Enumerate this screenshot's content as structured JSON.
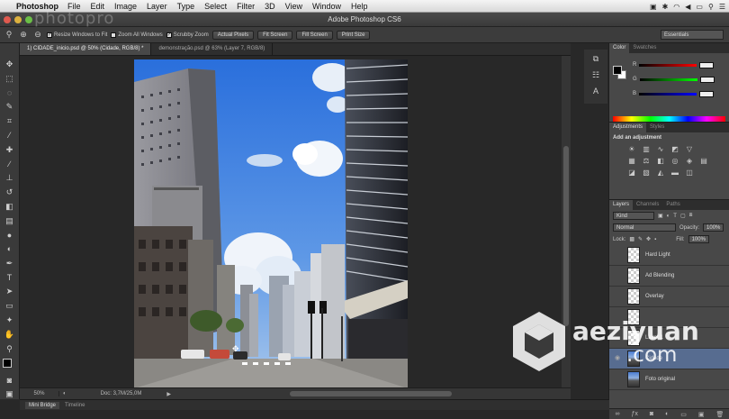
{
  "menubar": {
    "app_name": "Photoshop",
    "items": [
      "File",
      "Edit",
      "Image",
      "Layer",
      "Type",
      "Select",
      "Filter",
      "3D",
      "View",
      "Window",
      "Help"
    ]
  },
  "titlebar": {
    "title": "Adobe Photoshop CS6"
  },
  "watermark_top": "photopro",
  "options_bar": {
    "resize_windows": "Resize Windows to Fit",
    "zoom_all": "Zoom All Windows",
    "scrubby": "Scrubby Zoom",
    "actual_pixels": "Actual Pixels",
    "fit_screen": "Fit Screen",
    "fill_screen": "Fill Screen",
    "print_size": "Print Size",
    "workspace": "Essentials"
  },
  "tabs": [
    {
      "label": "1) CIDADE_inicio.psd @ 50% (Cidade, RGB/8) *"
    },
    {
      "label": "demonstração.psd @ 63% (Layer 7, RGB/8)"
    }
  ],
  "status": {
    "zoom": "50%",
    "doc": "Doc: 3,7M/25,0M"
  },
  "bottom_tabs": {
    "mini_bridge": "Mini Bridge",
    "timeline": "Timeline"
  },
  "color_panel": {
    "tabs": [
      "Color",
      "Swatches"
    ],
    "labels": [
      "R",
      "G",
      "B"
    ]
  },
  "adjustments_panel": {
    "tabs": [
      "Adjustments",
      "Styles"
    ],
    "title": "Add an adjustment"
  },
  "layers_panel": {
    "tabs": [
      "Layers",
      "Channels",
      "Paths"
    ],
    "kind": "Kind",
    "blend_mode": "Normal",
    "opacity_label": "Opacity:",
    "opacity": "100%",
    "lock_label": "Lock:",
    "fill_label": "Fill:",
    "fill": "100%",
    "layers": [
      {
        "name": "Hard Light",
        "selected": false
      },
      {
        "name": "Ad Blending",
        "selected": false
      },
      {
        "name": "Overlay",
        "selected": false
      },
      {
        "name": "",
        "selected": false
      },
      {
        "name": "Layer 1",
        "selected": false
      },
      {
        "name": "Cidade",
        "selected": true
      },
      {
        "name": "Foto original",
        "selected": false
      }
    ]
  },
  "watermark": {
    "line1": "aeziyuan",
    "line2": ".com"
  },
  "colors": {
    "selected_layer": "#576c90",
    "chrome_dark": "#282828"
  }
}
